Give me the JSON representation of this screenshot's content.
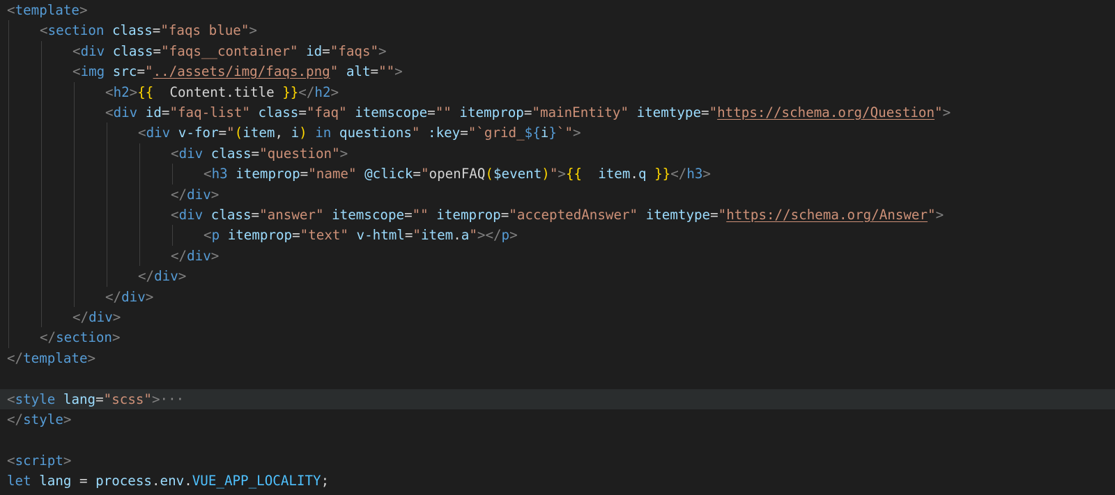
{
  "editor": {
    "language": "vue",
    "current_line_index": 19,
    "lines": [
      {
        "indent": 0,
        "tokens": [
          [
            "t-punc",
            "<"
          ],
          [
            "t-tag",
            "template"
          ],
          [
            "t-punc",
            ">"
          ]
        ]
      },
      {
        "indent": 1,
        "tokens": [
          [
            "t-punc",
            "<"
          ],
          [
            "t-tag",
            "section"
          ],
          [
            "t-plain",
            " "
          ],
          [
            "t-attr",
            "class"
          ],
          [
            "t-plain",
            "="
          ],
          [
            "t-str",
            "\"faqs blue\""
          ],
          [
            "t-punc",
            ">"
          ]
        ]
      },
      {
        "indent": 2,
        "tokens": [
          [
            "t-punc",
            "<"
          ],
          [
            "t-tag",
            "div"
          ],
          [
            "t-plain",
            " "
          ],
          [
            "t-attr",
            "class"
          ],
          [
            "t-plain",
            "="
          ],
          [
            "t-str",
            "\"faqs__container\""
          ],
          [
            "t-plain",
            " "
          ],
          [
            "t-attr",
            "id"
          ],
          [
            "t-plain",
            "="
          ],
          [
            "t-str",
            "\"faqs\""
          ],
          [
            "t-punc",
            ">"
          ]
        ]
      },
      {
        "indent": 2,
        "tokens": [
          [
            "t-punc",
            "<"
          ],
          [
            "t-tag",
            "img"
          ],
          [
            "t-plain",
            " "
          ],
          [
            "t-attr",
            "src"
          ],
          [
            "t-plain",
            "="
          ],
          [
            "t-str",
            "\""
          ],
          [
            "t-url",
            "../assets/img/faqs.png"
          ],
          [
            "t-str",
            "\""
          ],
          [
            "t-plain",
            " "
          ],
          [
            "t-attr",
            "alt"
          ],
          [
            "t-plain",
            "="
          ],
          [
            "t-str",
            "\"\""
          ],
          [
            "t-punc",
            ">"
          ]
        ]
      },
      {
        "indent": 3,
        "tokens": [
          [
            "t-punc",
            "<"
          ],
          [
            "t-tag",
            "h2"
          ],
          [
            "t-punc",
            ">"
          ],
          [
            "t-brace",
            "{{"
          ],
          [
            "t-plain",
            "  Content.title "
          ],
          [
            "t-brace",
            "}}"
          ],
          [
            "t-punc",
            "</"
          ],
          [
            "t-tag",
            "h2"
          ],
          [
            "t-punc",
            ">"
          ]
        ]
      },
      {
        "indent": 3,
        "tokens": [
          [
            "t-punc",
            "<"
          ],
          [
            "t-tag",
            "div"
          ],
          [
            "t-plain",
            " "
          ],
          [
            "t-attr",
            "id"
          ],
          [
            "t-plain",
            "="
          ],
          [
            "t-str",
            "\"faq-list\""
          ],
          [
            "t-plain",
            " "
          ],
          [
            "t-attr",
            "class"
          ],
          [
            "t-plain",
            "="
          ],
          [
            "t-str",
            "\"faq\""
          ],
          [
            "t-plain",
            " "
          ],
          [
            "t-attr",
            "itemscope"
          ],
          [
            "t-plain",
            "="
          ],
          [
            "t-str",
            "\"\""
          ],
          [
            "t-plain",
            " "
          ],
          [
            "t-attr",
            "itemprop"
          ],
          [
            "t-plain",
            "="
          ],
          [
            "t-str",
            "\"mainEntity\""
          ],
          [
            "t-plain",
            " "
          ],
          [
            "t-attr",
            "itemtype"
          ],
          [
            "t-plain",
            "="
          ],
          [
            "t-str",
            "\""
          ],
          [
            "t-url",
            "https://schema.org/Question"
          ],
          [
            "t-str",
            "\""
          ],
          [
            "t-punc",
            ">"
          ]
        ]
      },
      {
        "indent": 4,
        "tokens": [
          [
            "t-punc",
            "<"
          ],
          [
            "t-tag",
            "div"
          ],
          [
            "t-plain",
            " "
          ],
          [
            "t-attr",
            "v-for"
          ],
          [
            "t-plain",
            "="
          ],
          [
            "t-str",
            "\""
          ],
          [
            "t-brace",
            "("
          ],
          [
            "t-attr",
            "item"
          ],
          [
            "t-plain",
            ", "
          ],
          [
            "t-attr",
            "i"
          ],
          [
            "t-brace",
            ")"
          ],
          [
            "t-plain",
            " "
          ],
          [
            "t-kw",
            "in"
          ],
          [
            "t-plain",
            " "
          ],
          [
            "t-attr",
            "questions"
          ],
          [
            "t-str",
            "\""
          ],
          [
            "t-plain",
            " "
          ],
          [
            "t-attr",
            ":key"
          ],
          [
            "t-plain",
            "="
          ],
          [
            "t-str",
            "\"`grid_"
          ],
          [
            "t-kw",
            "${"
          ],
          [
            "t-attr",
            "i"
          ],
          [
            "t-kw",
            "}"
          ],
          [
            "t-str",
            "`\""
          ],
          [
            "t-punc",
            ">"
          ]
        ]
      },
      {
        "indent": 5,
        "tokens": [
          [
            "t-punc",
            "<"
          ],
          [
            "t-tag",
            "div"
          ],
          [
            "t-plain",
            " "
          ],
          [
            "t-attr",
            "class"
          ],
          [
            "t-plain",
            "="
          ],
          [
            "t-str",
            "\"question\""
          ],
          [
            "t-punc",
            ">"
          ]
        ]
      },
      {
        "indent": 6,
        "tokens": [
          [
            "t-punc",
            "<"
          ],
          [
            "t-tag",
            "h3"
          ],
          [
            "t-plain",
            " "
          ],
          [
            "t-attr",
            "itemprop"
          ],
          [
            "t-plain",
            "="
          ],
          [
            "t-str",
            "\"name\""
          ],
          [
            "t-plain",
            " "
          ],
          [
            "t-attr",
            "@click"
          ],
          [
            "t-plain",
            "="
          ],
          [
            "t-str",
            "\""
          ],
          [
            "t-plain",
            "openFAQ"
          ],
          [
            "t-brace",
            "("
          ],
          [
            "t-attr",
            "$event"
          ],
          [
            "t-brace",
            ")"
          ],
          [
            "t-str",
            "\""
          ],
          [
            "t-punc",
            ">"
          ],
          [
            "t-brace",
            "{{"
          ],
          [
            "t-plain",
            "  "
          ],
          [
            "t-attr",
            "item"
          ],
          [
            "t-plain",
            "."
          ],
          [
            "t-attr",
            "q"
          ],
          [
            "t-plain",
            " "
          ],
          [
            "t-brace",
            "}}"
          ],
          [
            "t-punc",
            "</"
          ],
          [
            "t-tag",
            "h3"
          ],
          [
            "t-punc",
            ">"
          ]
        ]
      },
      {
        "indent": 5,
        "tokens": [
          [
            "t-punc",
            "</"
          ],
          [
            "t-tag",
            "div"
          ],
          [
            "t-punc",
            ">"
          ]
        ]
      },
      {
        "indent": 5,
        "tokens": [
          [
            "t-punc",
            "<"
          ],
          [
            "t-tag",
            "div"
          ],
          [
            "t-plain",
            " "
          ],
          [
            "t-attr",
            "class"
          ],
          [
            "t-plain",
            "="
          ],
          [
            "t-str",
            "\"answer\""
          ],
          [
            "t-plain",
            " "
          ],
          [
            "t-attr",
            "itemscope"
          ],
          [
            "t-plain",
            "="
          ],
          [
            "t-str",
            "\"\""
          ],
          [
            "t-plain",
            " "
          ],
          [
            "t-attr",
            "itemprop"
          ],
          [
            "t-plain",
            "="
          ],
          [
            "t-str",
            "\"acceptedAnswer\""
          ],
          [
            "t-plain",
            " "
          ],
          [
            "t-attr",
            "itemtype"
          ],
          [
            "t-plain",
            "="
          ],
          [
            "t-str",
            "\""
          ],
          [
            "t-url",
            "https://schema.org/Answer"
          ],
          [
            "t-str",
            "\""
          ],
          [
            "t-punc",
            ">"
          ]
        ]
      },
      {
        "indent": 6,
        "tokens": [
          [
            "t-punc",
            "<"
          ],
          [
            "t-tag",
            "p"
          ],
          [
            "t-plain",
            " "
          ],
          [
            "t-attr",
            "itemprop"
          ],
          [
            "t-plain",
            "="
          ],
          [
            "t-str",
            "\"text\""
          ],
          [
            "t-plain",
            " "
          ],
          [
            "t-attr",
            "v-html"
          ],
          [
            "t-plain",
            "="
          ],
          [
            "t-str",
            "\""
          ],
          [
            "t-attr",
            "item"
          ],
          [
            "t-plain",
            "."
          ],
          [
            "t-attr",
            "a"
          ],
          [
            "t-str",
            "\""
          ],
          [
            "t-punc",
            "></"
          ],
          [
            "t-tag",
            "p"
          ],
          [
            "t-punc",
            ">"
          ]
        ]
      },
      {
        "indent": 5,
        "tokens": [
          [
            "t-punc",
            "</"
          ],
          [
            "t-tag",
            "div"
          ],
          [
            "t-punc",
            ">"
          ]
        ]
      },
      {
        "indent": 4,
        "tokens": [
          [
            "t-punc",
            "</"
          ],
          [
            "t-tag",
            "div"
          ],
          [
            "t-punc",
            ">"
          ]
        ]
      },
      {
        "indent": 3,
        "tokens": [
          [
            "t-punc",
            "</"
          ],
          [
            "t-tag",
            "div"
          ],
          [
            "t-punc",
            ">"
          ]
        ]
      },
      {
        "indent": 2,
        "tokens": [
          [
            "t-punc",
            "</"
          ],
          [
            "t-tag",
            "div"
          ],
          [
            "t-punc",
            ">"
          ]
        ]
      },
      {
        "indent": 1,
        "tokens": [
          [
            "t-punc",
            "</"
          ],
          [
            "t-tag",
            "section"
          ],
          [
            "t-punc",
            ">"
          ]
        ]
      },
      {
        "indent": 0,
        "tokens": [
          [
            "t-punc",
            "</"
          ],
          [
            "t-tag",
            "template"
          ],
          [
            "t-punc",
            ">"
          ]
        ]
      },
      {
        "indent": 0,
        "tokens": []
      },
      {
        "indent": 0,
        "tokens": [
          [
            "t-punc",
            "<"
          ],
          [
            "t-tag",
            "style"
          ],
          [
            "t-plain",
            " "
          ],
          [
            "t-attr",
            "lang"
          ],
          [
            "t-plain",
            "="
          ],
          [
            "t-str",
            "\"scss\""
          ],
          [
            "t-punc",
            ">"
          ],
          [
            "t-fold",
            "···"
          ]
        ]
      },
      {
        "indent": 0,
        "tokens": [
          [
            "t-punc",
            "</"
          ],
          [
            "t-tag",
            "style"
          ],
          [
            "t-punc",
            ">"
          ]
        ]
      },
      {
        "indent": 0,
        "tokens": []
      },
      {
        "indent": 0,
        "tokens": [
          [
            "t-punc",
            "<"
          ],
          [
            "t-tag",
            "script"
          ],
          [
            "t-punc",
            ">"
          ]
        ]
      },
      {
        "indent": 0,
        "tokens": [
          [
            "t-kw",
            "let"
          ],
          [
            "t-plain",
            " "
          ],
          [
            "t-attr",
            "lang"
          ],
          [
            "t-plain",
            " = "
          ],
          [
            "t-attr",
            "process"
          ],
          [
            "t-plain",
            "."
          ],
          [
            "t-attr",
            "env"
          ],
          [
            "t-plain",
            "."
          ],
          [
            "t-const",
            "VUE_APP_LOCALITY"
          ],
          [
            "t-plain",
            ";"
          ]
        ]
      }
    ]
  },
  "colors": {
    "background": "#1e1e1e",
    "current_line": "#2a2d2e",
    "tag": "#569cd6",
    "attribute": "#9cdcfe",
    "string": "#ce9178",
    "brace": "#ffd700",
    "constant": "#4fc1ff"
  }
}
